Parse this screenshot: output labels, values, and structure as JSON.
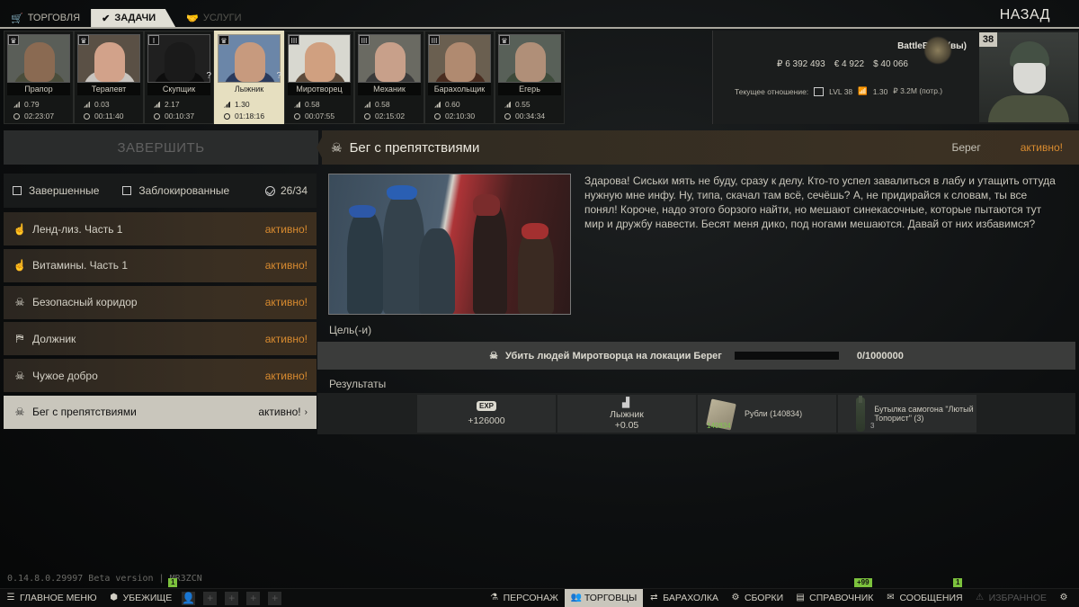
{
  "top_tabs": [
    {
      "label": "ТОРГОВЛЯ",
      "icon": "cart-icon"
    },
    {
      "label": "ЗАДАЧИ",
      "icon": "check-circle-icon",
      "active": true
    },
    {
      "label": "УСЛУГИ",
      "icon": "handshake-icon",
      "disabled": true
    }
  ],
  "back_label": "НАЗАД",
  "traders": [
    {
      "name": "Прапор",
      "badge": "♛",
      "rep": "0.79",
      "time": "02:23:07",
      "face": "#8a6a52",
      "body": "#4a4d3b",
      "bg": "#5a5e58"
    },
    {
      "name": "Терапевт",
      "badge": "♛",
      "rep": "0.03",
      "time": "00:11:40",
      "face": "#d2a28a",
      "body": "#c9c5c0",
      "bg": "#5a5045"
    },
    {
      "name": "Скупщик",
      "badge": "I",
      "q": "?",
      "rep": "2.17",
      "time": "00:10:37",
      "face": "#1a1a1a",
      "body": "#0d0d0d",
      "bg": "#202020"
    },
    {
      "name": "Лыжник",
      "badge": "♛",
      "q": "?",
      "rep": "1.30",
      "time": "01:18:16",
      "face": "#c79a7e",
      "body": "#2a3a5c",
      "bg": "#6b86a8",
      "selected": true
    },
    {
      "name": "Миротворец",
      "badge": "III",
      "rep": "0.58",
      "time": "00:07:55",
      "face": "#d0a080",
      "body": "#5c4a3a",
      "bg": "#d8d8d0"
    },
    {
      "name": "Механик",
      "badge": "III",
      "rep": "0.58",
      "time": "02:15:02",
      "face": "#c8a08a",
      "body": "#3a3a3a",
      "bg": "#6a6a62"
    },
    {
      "name": "Барахольщик",
      "badge": "III",
      "rep": "0.60",
      "time": "02:10:30",
      "face": "#b08a70",
      "body": "#4a2d20",
      "bg": "#6a5f50"
    },
    {
      "name": "Егерь",
      "badge": "♛",
      "rep": "0.55",
      "time": "00:34:34",
      "face": "#b08f78",
      "body": "#3d4a3a",
      "bg": "#586058"
    }
  ],
  "player": {
    "name": "BattleBomj (вы)",
    "rubles": "₽ 6 392 493",
    "euros": "€ 4 922",
    "dollars": "$ 40 066",
    "relation_label": "Текущее отношение:",
    "relation_lvl": "LVL 38",
    "relation_rep": "1.30",
    "relation_spent": "₽ 3.2M (потр.)",
    "level": "38"
  },
  "finish_label": "ЗАВЕРШИТЬ",
  "filters": {
    "completed": "Завершенные",
    "locked": "Заблокированные",
    "count": "26/34"
  },
  "quests": [
    {
      "title": "Ленд-лиз. Часть 1",
      "status": "активно!",
      "icon": "☝"
    },
    {
      "title": "Витамины. Часть 1",
      "status": "активно!",
      "icon": "☝"
    },
    {
      "title": "Безопасный коридор",
      "status": "активно!",
      "icon": "☠"
    },
    {
      "title": "Должник",
      "status": "активно!",
      "icon": "⛿"
    },
    {
      "title": "Чужое добро",
      "status": "активно!",
      "icon": "☠"
    },
    {
      "title": "Бег с препятствиями",
      "status": "активно!",
      "icon": "☠",
      "selected": true
    }
  ],
  "quest_detail": {
    "title": "Бег с препятствиями",
    "location": "Берег",
    "status": "активно!",
    "description": "Здарова! Сиськи мять не буду, сразу к делу. Кто-то успел завалиться в лабу и утащить оттуда нужную мне инфу. Ну, типа, скачал там всё, сечёшь? А, не придирайся к словам, ты все понял! Короче, надо этого борзого найти, но мешают синекасочные, которые пытаются тут мир и дружбу навести. Бесят меня дико, под ногами мешаются. Давай от них избавимся?",
    "goals_label": "Цель(-и)",
    "goal_text": "Убить людей Миротворца на локации Берег",
    "goal_progress": 0,
    "goal_count": "0/1000000",
    "results_label": "Результаты",
    "rewards": {
      "exp_label": "EXP",
      "exp_value": "+126000",
      "rep_trader": "Лыжник",
      "rep_value": "+0.05",
      "money_label": "Рубли (140834)",
      "money_qty": "140834",
      "bottle_label": "Бутылка самогона \"Лютый Топорист\" (3)",
      "bottle_qty": "3"
    }
  },
  "version": "0.14.8.0.29997 Beta version | MR3ZCN",
  "badges": {
    "left": "1",
    "middle": "+99",
    "right": "1"
  },
  "bottom_bar": {
    "main_menu": "ГЛАВНОЕ МЕНЮ",
    "hideout": "УБЕЖИЩЕ",
    "character": "ПЕРСОНАЖ",
    "traders": "ТОРГОВЦЫ",
    "flea": "БАРАХОЛКА",
    "builds": "СБОРКИ",
    "handbook": "СПРАВОЧНИК",
    "messages": "СООБЩЕНИЯ",
    "favorites": "ИЗБРАННОЕ"
  }
}
